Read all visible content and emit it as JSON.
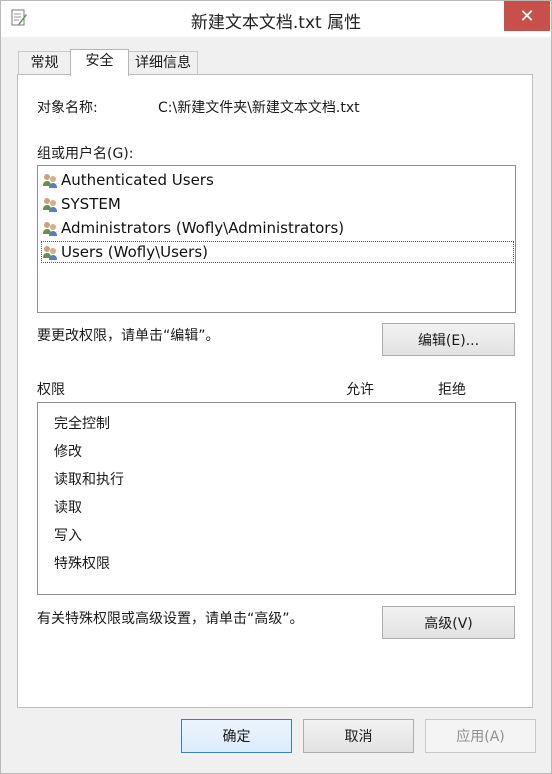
{
  "window": {
    "title": "新建文本文档.txt 属性",
    "close_glyph": "✕"
  },
  "tabs": [
    {
      "label": "常规"
    },
    {
      "label": "安全"
    },
    {
      "label": "详细信息"
    }
  ],
  "security": {
    "object_name_label": "对象名称:",
    "object_name_value": "C:\\新建文件夹\\新建文本文档.txt",
    "groups_label": "组或用户名(G):",
    "groups": [
      {
        "name": "Authenticated Users",
        "icon": "user-group-icon"
      },
      {
        "name": "SYSTEM",
        "icon": "user-group-icon"
      },
      {
        "name": "Administrators (Wofly\\Administrators)",
        "icon": "user-group-icon"
      },
      {
        "name": "Users (Wofly\\Users)",
        "icon": "user-group-icon",
        "selected": true
      }
    ],
    "edit_hint": "要更改权限，请单击“编辑”。",
    "edit_button": "编辑(E)...",
    "permissions_label": "权限",
    "allow_label": "允许",
    "deny_label": "拒绝",
    "permissions": [
      "完全控制",
      "修改",
      "读取和执行",
      "读取",
      "写入",
      "特殊权限"
    ],
    "advanced_hint": "有关特殊权限或高级设置，请单击“高级”。",
    "advanced_button": "高级(V)"
  },
  "footer": {
    "ok": "确定",
    "cancel": "取消",
    "apply": "应用(A)"
  }
}
